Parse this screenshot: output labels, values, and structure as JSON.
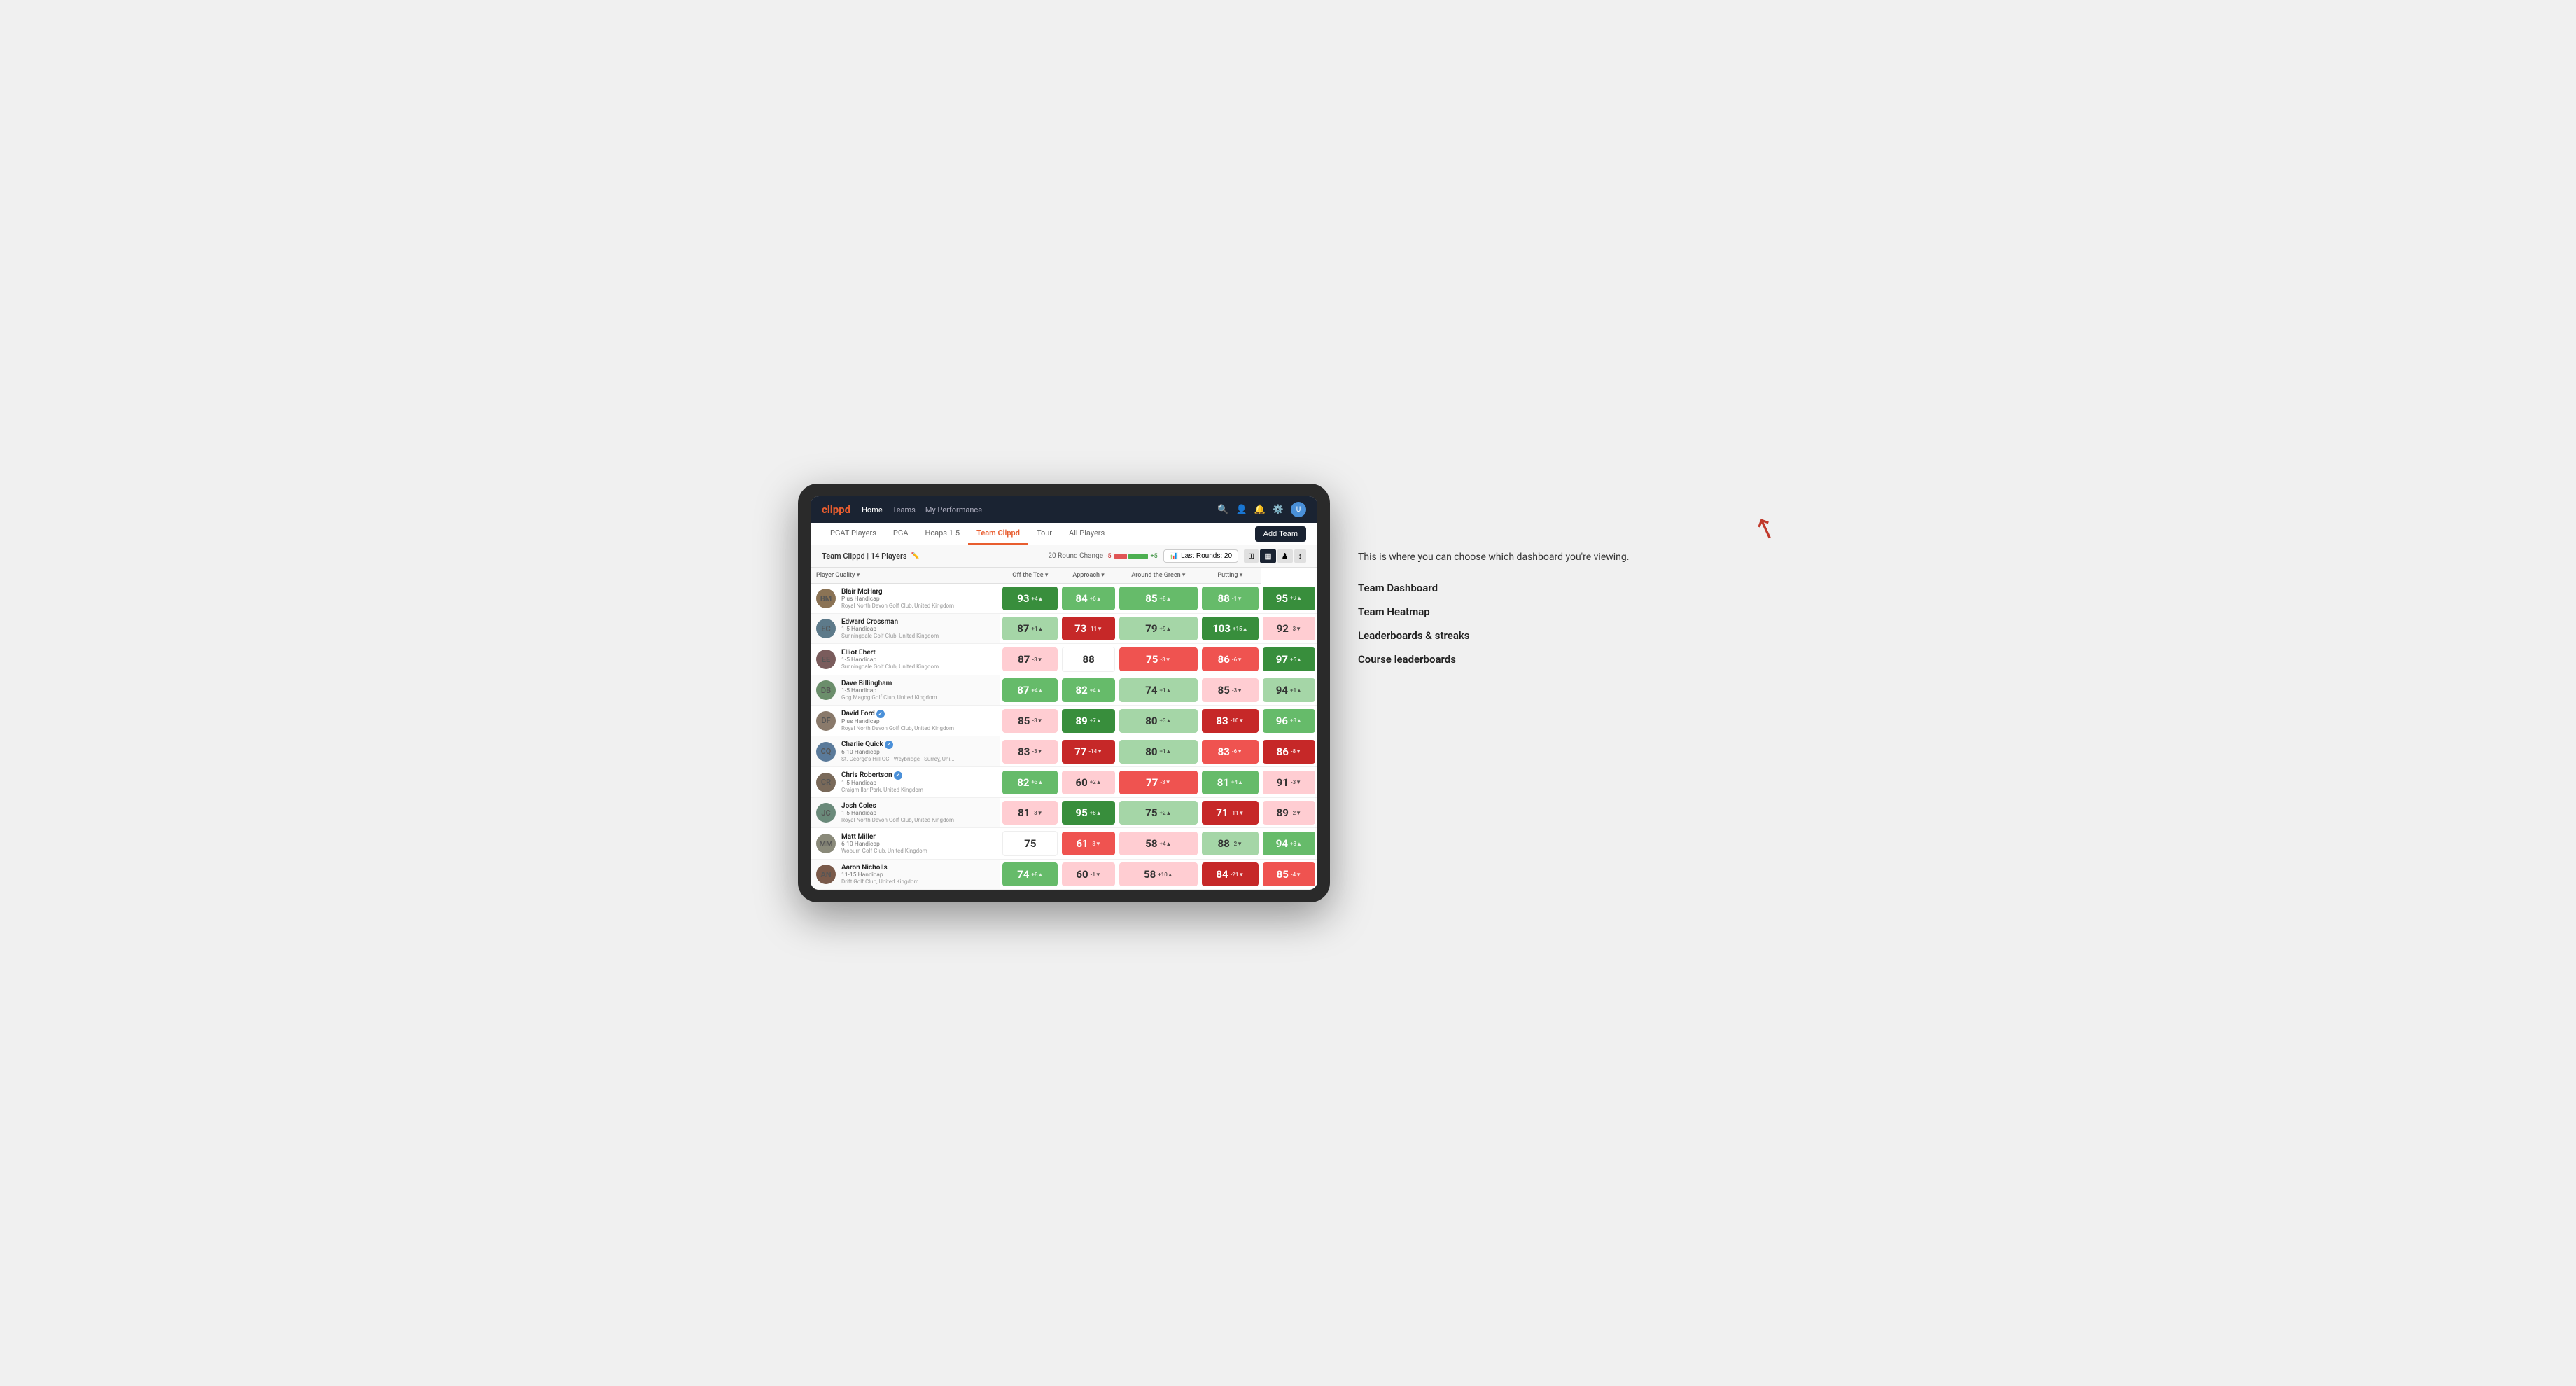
{
  "brand": {
    "logo": "clippd",
    "nav_links": [
      "Home",
      "Teams",
      "My Performance"
    ]
  },
  "subnav": {
    "tabs": [
      "PGAT Players",
      "PGA",
      "Hcaps 1-5",
      "Team Clippd",
      "Tour",
      "All Players"
    ],
    "active_tab": "Team Clippd",
    "add_team_label": "Add Team"
  },
  "team_header": {
    "team_name": "Team Clippd",
    "player_count": "14 Players",
    "round_change_label": "20 Round Change",
    "change_minus": "-5",
    "change_plus": "+5",
    "last_rounds_label": "Last Rounds:",
    "last_rounds_value": "20"
  },
  "table": {
    "columns": {
      "player": "Player Quality",
      "off_tee": "Off the Tee",
      "approach": "Approach",
      "around_green": "Around the Green",
      "putting": "Putting"
    },
    "rows": [
      {
        "name": "Blair McHarg",
        "handicap": "Plus Handicap",
        "club": "Royal North Devon Golf Club, United Kingdom",
        "initials": "BM",
        "avatar_color": "#8B7355",
        "player_quality": {
          "value": 93,
          "change": "+4",
          "dir": "up",
          "bg": "bg-green-dark"
        },
        "off_tee": {
          "value": 84,
          "change": "+6",
          "dir": "up",
          "bg": "bg-green-medium"
        },
        "approach": {
          "value": 85,
          "change": "+8",
          "dir": "up",
          "bg": "bg-green-medium"
        },
        "around_green": {
          "value": 88,
          "change": "-1",
          "dir": "down",
          "bg": "bg-green-medium"
        },
        "putting": {
          "value": 95,
          "change": "+9",
          "dir": "up",
          "bg": "bg-green-dark"
        }
      },
      {
        "name": "Edward Crossman",
        "handicap": "1-5 Handicap",
        "club": "Sunningdale Golf Club, United Kingdom",
        "initials": "EC",
        "avatar_color": "#5d7a8a",
        "player_quality": {
          "value": 87,
          "change": "+1",
          "dir": "up",
          "bg": "bg-green-light"
        },
        "off_tee": {
          "value": 73,
          "change": "-11",
          "dir": "down",
          "bg": "bg-red-dark"
        },
        "approach": {
          "value": 79,
          "change": "+9",
          "dir": "up",
          "bg": "bg-green-light"
        },
        "around_green": {
          "value": 103,
          "change": "+15",
          "dir": "up",
          "bg": "bg-green-dark"
        },
        "putting": {
          "value": 92,
          "change": "-3",
          "dir": "down",
          "bg": "bg-red-light"
        }
      },
      {
        "name": "Elliot Ebert",
        "handicap": "1-5 Handicap",
        "club": "Sunningdale Golf Club, United Kingdom",
        "initials": "EE",
        "avatar_color": "#7a5c5c",
        "player_quality": {
          "value": 87,
          "change": "-3",
          "dir": "down",
          "bg": "bg-red-light"
        },
        "off_tee": {
          "value": 88,
          "change": "",
          "dir": "",
          "bg": "bg-white"
        },
        "approach": {
          "value": 75,
          "change": "-3",
          "dir": "down",
          "bg": "bg-red-medium"
        },
        "around_green": {
          "value": 86,
          "change": "-6",
          "dir": "down",
          "bg": "bg-red-medium"
        },
        "putting": {
          "value": 97,
          "change": "+5",
          "dir": "up",
          "bg": "bg-green-dark"
        }
      },
      {
        "name": "Dave Billingham",
        "handicap": "1-5 Handicap",
        "club": "Gog Magog Golf Club, United Kingdom",
        "initials": "DB",
        "avatar_color": "#6b8e6b",
        "player_quality": {
          "value": 87,
          "change": "+4",
          "dir": "up",
          "bg": "bg-green-medium"
        },
        "off_tee": {
          "value": 82,
          "change": "+4",
          "dir": "up",
          "bg": "bg-green-medium"
        },
        "approach": {
          "value": 74,
          "change": "+1",
          "dir": "up",
          "bg": "bg-green-light"
        },
        "around_green": {
          "value": 85,
          "change": "-3",
          "dir": "down",
          "bg": "bg-red-light"
        },
        "putting": {
          "value": 94,
          "change": "+1",
          "dir": "up",
          "bg": "bg-green-light"
        }
      },
      {
        "name": "David Ford",
        "handicap": "Plus Handicap",
        "club": "Royal North Devon Golf Club, United Kingdom",
        "initials": "DF",
        "avatar_color": "#8a7a6b",
        "verified": true,
        "player_quality": {
          "value": 85,
          "change": "-3",
          "dir": "down",
          "bg": "bg-red-light"
        },
        "off_tee": {
          "value": 89,
          "change": "+7",
          "dir": "up",
          "bg": "bg-green-dark"
        },
        "approach": {
          "value": 80,
          "change": "+3",
          "dir": "up",
          "bg": "bg-green-light"
        },
        "around_green": {
          "value": 83,
          "change": "-10",
          "dir": "down",
          "bg": "bg-red-dark"
        },
        "putting": {
          "value": 96,
          "change": "+3",
          "dir": "up",
          "bg": "bg-green-medium"
        }
      },
      {
        "name": "Charlie Quick",
        "handicap": "6-10 Handicap",
        "club": "St. George's Hill GC - Weybridge - Surrey, Uni...",
        "initials": "CQ",
        "avatar_color": "#5a7a9a",
        "verified": true,
        "player_quality": {
          "value": 83,
          "change": "-3",
          "dir": "down",
          "bg": "bg-red-light"
        },
        "off_tee": {
          "value": 77,
          "change": "-14",
          "dir": "down",
          "bg": "bg-red-dark"
        },
        "approach": {
          "value": 80,
          "change": "+1",
          "dir": "up",
          "bg": "bg-green-light"
        },
        "around_green": {
          "value": 83,
          "change": "-6",
          "dir": "down",
          "bg": "bg-red-medium"
        },
        "putting": {
          "value": 86,
          "change": "-8",
          "dir": "down",
          "bg": "bg-red-dark"
        }
      },
      {
        "name": "Chris Robertson",
        "handicap": "1-5 Handicap",
        "club": "Craigmillar Park, United Kingdom",
        "initials": "CR",
        "avatar_color": "#7a6a5a",
        "verified": true,
        "player_quality": {
          "value": 82,
          "change": "+3",
          "dir": "up",
          "bg": "bg-green-medium"
        },
        "off_tee": {
          "value": 60,
          "change": "+2",
          "dir": "up",
          "bg": "bg-red-light"
        },
        "approach": {
          "value": 77,
          "change": "-3",
          "dir": "down",
          "bg": "bg-red-medium"
        },
        "around_green": {
          "value": 81,
          "change": "+4",
          "dir": "up",
          "bg": "bg-green-medium"
        },
        "putting": {
          "value": 91,
          "change": "-3",
          "dir": "down",
          "bg": "bg-red-light"
        }
      },
      {
        "name": "Josh Coles",
        "handicap": "1-5 Handicap",
        "club": "Royal North Devon Golf Club, United Kingdom",
        "initials": "JC",
        "avatar_color": "#6a8a7a",
        "player_quality": {
          "value": 81,
          "change": "-3",
          "dir": "down",
          "bg": "bg-red-light"
        },
        "off_tee": {
          "value": 95,
          "change": "+8",
          "dir": "up",
          "bg": "bg-green-dark"
        },
        "approach": {
          "value": 75,
          "change": "+2",
          "dir": "up",
          "bg": "bg-green-light"
        },
        "around_green": {
          "value": 71,
          "change": "-11",
          "dir": "down",
          "bg": "bg-red-dark"
        },
        "putting": {
          "value": 89,
          "change": "-2",
          "dir": "down",
          "bg": "bg-red-light"
        }
      },
      {
        "name": "Matt Miller",
        "handicap": "6-10 Handicap",
        "club": "Woburn Golf Club, United Kingdom",
        "initials": "MM",
        "avatar_color": "#8a8a7a",
        "player_quality": {
          "value": 75,
          "change": "",
          "dir": "",
          "bg": "bg-white"
        },
        "off_tee": {
          "value": 61,
          "change": "-3",
          "dir": "down",
          "bg": "bg-red-medium"
        },
        "approach": {
          "value": 58,
          "change": "+4",
          "dir": "up",
          "bg": "bg-red-light"
        },
        "around_green": {
          "value": 88,
          "change": "-2",
          "dir": "down",
          "bg": "bg-green-light"
        },
        "putting": {
          "value": 94,
          "change": "+3",
          "dir": "up",
          "bg": "bg-green-medium"
        }
      },
      {
        "name": "Aaron Nicholls",
        "handicap": "11-15 Handicap",
        "club": "Drift Golf Club, United Kingdom",
        "initials": "AN",
        "avatar_color": "#7a5a4a",
        "player_quality": {
          "value": 74,
          "change": "+8",
          "dir": "up",
          "bg": "bg-green-medium"
        },
        "off_tee": {
          "value": 60,
          "change": "-1",
          "dir": "down",
          "bg": "bg-red-light"
        },
        "approach": {
          "value": 58,
          "change": "+10",
          "dir": "up",
          "bg": "bg-red-light"
        },
        "around_green": {
          "value": 84,
          "change": "-21",
          "dir": "down",
          "bg": "bg-red-dark"
        },
        "putting": {
          "value": 85,
          "change": "-4",
          "dir": "down",
          "bg": "bg-red-medium"
        }
      }
    ]
  },
  "annotation": {
    "intro": "This is where you can choose which dashboard you're viewing.",
    "items": [
      "Team Dashboard",
      "Team Heatmap",
      "Leaderboards & streaks",
      "Course leaderboards"
    ]
  }
}
